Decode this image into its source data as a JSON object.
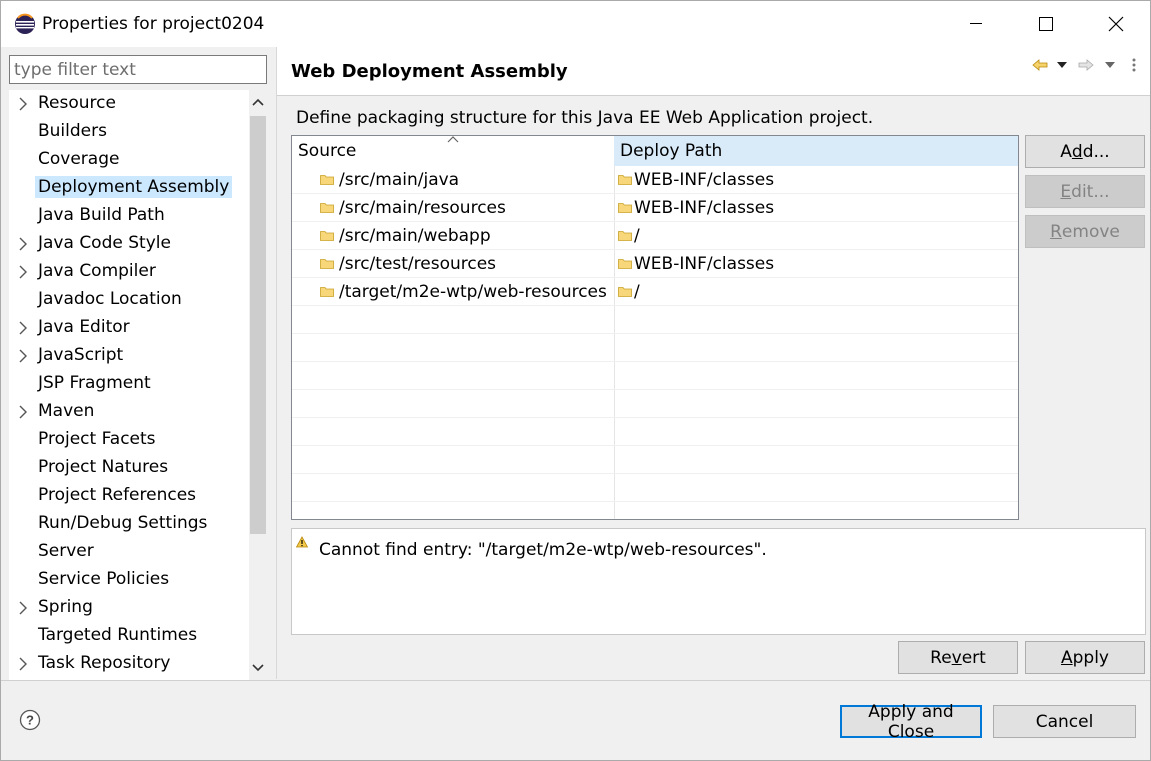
{
  "window": {
    "title": "Properties for project0204",
    "icons": {
      "app": "eclipse-icon",
      "minimize": "minimize-icon",
      "maximize": "maximize-icon",
      "close": "close-icon"
    }
  },
  "filter": {
    "placeholder": "type filter text",
    "value": ""
  },
  "tree": {
    "items": [
      {
        "label": "Resource",
        "expandable": true,
        "selected": false
      },
      {
        "label": "Builders",
        "expandable": false,
        "selected": false
      },
      {
        "label": "Coverage",
        "expandable": false,
        "selected": false
      },
      {
        "label": "Deployment Assembly",
        "expandable": false,
        "selected": true
      },
      {
        "label": "Java Build Path",
        "expandable": false,
        "selected": false
      },
      {
        "label": "Java Code Style",
        "expandable": true,
        "selected": false
      },
      {
        "label": "Java Compiler",
        "expandable": true,
        "selected": false
      },
      {
        "label": "Javadoc Location",
        "expandable": false,
        "selected": false
      },
      {
        "label": "Java Editor",
        "expandable": true,
        "selected": false
      },
      {
        "label": "JavaScript",
        "expandable": true,
        "selected": false
      },
      {
        "label": "JSP Fragment",
        "expandable": false,
        "selected": false
      },
      {
        "label": "Maven",
        "expandable": true,
        "selected": false
      },
      {
        "label": "Project Facets",
        "expandable": false,
        "selected": false
      },
      {
        "label": "Project Natures",
        "expandable": false,
        "selected": false
      },
      {
        "label": "Project References",
        "expandable": false,
        "selected": false
      },
      {
        "label": "Run/Debug Settings",
        "expandable": false,
        "selected": false
      },
      {
        "label": "Server",
        "expandable": false,
        "selected": false
      },
      {
        "label": "Service Policies",
        "expandable": false,
        "selected": false
      },
      {
        "label": "Spring",
        "expandable": true,
        "selected": false
      },
      {
        "label": "Targeted Runtimes",
        "expandable": false,
        "selected": false
      },
      {
        "label": "Task Repository",
        "expandable": true,
        "selected": false
      }
    ]
  },
  "page": {
    "title": "Web Deployment Assembly",
    "description": "Define packaging structure for this Java EE Web Application project.",
    "table": {
      "columns": [
        "Source",
        "Deploy Path"
      ],
      "sorted_column": "Source",
      "sort_direction": "ascending",
      "rows": [
        {
          "source": "/src/main/java",
          "deploy": "WEB-INF/classes"
        },
        {
          "source": "/src/main/resources",
          "deploy": "WEB-INF/classes"
        },
        {
          "source": "/src/main/webapp",
          "deploy": "/"
        },
        {
          "source": "/src/test/resources",
          "deploy": "WEB-INF/classes"
        },
        {
          "source": "/target/m2e-wtp/web-resources",
          "deploy": "/"
        }
      ]
    },
    "buttons": {
      "add": {
        "pre": "A",
        "mnemonic": "d",
        "post": "d...",
        "enabled": true
      },
      "edit": {
        "pre": "",
        "mnemonic": "E",
        "post": "dit...",
        "enabled": false
      },
      "remove": {
        "pre": "",
        "mnemonic": "R",
        "post": "emove",
        "enabled": false
      },
      "revert": {
        "pre": "Re",
        "mnemonic": "v",
        "post": "ert",
        "enabled": true
      },
      "apply": {
        "pre": "",
        "mnemonic": "A",
        "post": "pply",
        "enabled": true
      }
    },
    "message": {
      "icon": "warning-icon",
      "text": "Cannot find entry: \"/target/m2e-wtp/web-resources\"."
    }
  },
  "footer": {
    "apply_and_close": "Apply and Close",
    "cancel": "Cancel",
    "help_icon": "help-icon"
  },
  "colors": {
    "selection": "#cce8ff",
    "header_highlight": "#d9ebf9",
    "primary_border": "#0078d7",
    "warning": "#e8a317",
    "folder": "#e8c05a"
  }
}
